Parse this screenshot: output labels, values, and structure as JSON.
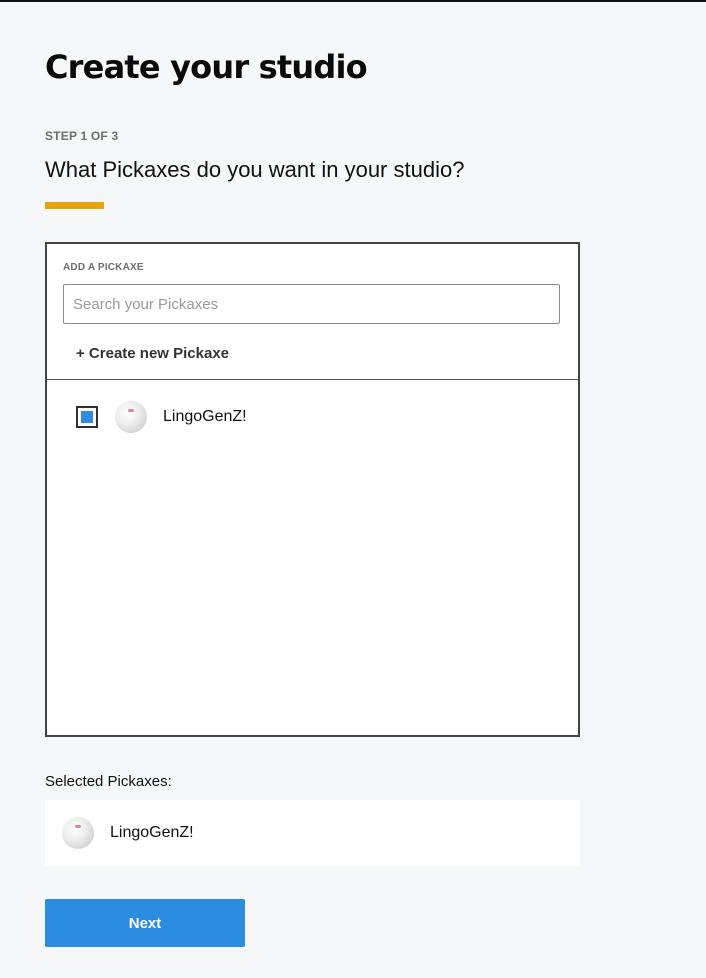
{
  "colors": {
    "accent_underline": "#e8a20c",
    "primary_button": "#2b8ce0",
    "checkbox_fill": "#2b8ce0"
  },
  "header": {
    "title": "Create your studio",
    "step": "STEP 1 OF 3",
    "question": "What Pickaxes do you want in your studio?"
  },
  "picker": {
    "section_label": "ADD A PICKAXE",
    "search_placeholder": "Search your Pickaxes",
    "search_value": "",
    "create_link": "+ Create new Pickaxe",
    "items": [
      {
        "name": "LingoGenZ!",
        "checked": true,
        "icon": "avatar-image"
      }
    ]
  },
  "selected": {
    "label": "Selected Pickaxes:",
    "items": [
      {
        "name": "LingoGenZ!",
        "icon": "avatar-image"
      }
    ]
  },
  "actions": {
    "next_label": "Next"
  }
}
